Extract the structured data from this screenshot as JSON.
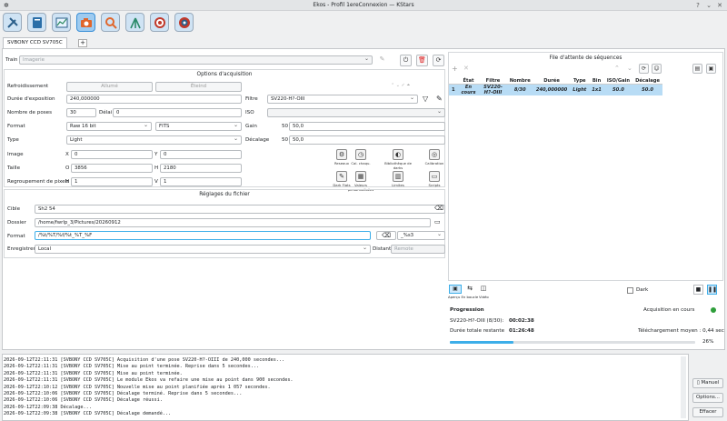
{
  "window": {
    "title": "Ekos - Profil 1ereConnexion — KStars"
  },
  "tab": {
    "label": "SVBONY CCD SV705C",
    "add": "+"
  },
  "train": {
    "label": "Train",
    "value": "Imagerie"
  },
  "acq": {
    "title": "Options d'acquisition",
    "cooling_label": "Refroidissement",
    "cooling_on": "Allumé",
    "cooling_off": "Éteind",
    "exposure_label": "Durée d'exposition",
    "exposure_value": "240,000000",
    "filter_label": "Filtre",
    "filter_value": "SV220-H?-OIII",
    "count_label": "Nombre de poses",
    "count_value": "30",
    "delay_label": "Délai",
    "delay_value": "0",
    "iso_label": "ISO",
    "format_label": "Format",
    "format_value": "Raw 16 bit",
    "encoding_value": "FITS",
    "gain_label": "Gain",
    "gain_min": "50",
    "gain_value": "50,0",
    "type_label": "Type",
    "type_value": "Light",
    "offset_label": "Décalage",
    "offset_min": "50",
    "offset_value": "50,0",
    "image_label": "Image",
    "x_label": "X",
    "x_value": "0",
    "y_label": "Y",
    "y_value": "0",
    "size_label": "Taille",
    "w_label": "O",
    "w_value": "3856",
    "h_label": "H",
    "h_value": "2180",
    "bin_label": "Regroupement de pixels",
    "binh_label": "H",
    "binh_value": "1",
    "binv_label": "V",
    "binv_value": "1"
  },
  "tools": [
    {
      "label": "Reseaux",
      "icon": "cooler-icon"
    },
    {
      "label": "Cal. chaqu.",
      "icon": "clock-icon"
    },
    {
      "label": "Bibliothèque de darks",
      "icon": "dark-library-icon"
    },
    {
      "label": "Calibration",
      "icon": "calibration-icon"
    },
    {
      "label": "Dark Flats",
      "icon": "dark-flats-icon"
    },
    {
      "label": "Valeurs personnalisées",
      "icon": "custom-values-icon"
    },
    {
      "label": "Limites",
      "icon": "limits-icon"
    },
    {
      "label": "Scripts",
      "icon": "scripts-icon"
    }
  ],
  "file": {
    "title": "Réglages du fichier",
    "target_label": "Cible",
    "target_value": "Sh2 54",
    "dir_label": "Dossier",
    "dir_value": "/home/fwrlp_3/Pictures/20260912",
    "format_label": "Format",
    "format_value": "/%t/%T/%f/%t_%T_%F",
    "suffix_value": "_%s3",
    "save_label": "Enregistrer",
    "save_value": "Local",
    "remote_label": "Distant",
    "remote_placeholder": "Remote"
  },
  "queue": {
    "title": "File d'attente de séquences",
    "headers": [
      "État",
      "Filtre",
      "Nombre",
      "Durée",
      "Type",
      "Bin",
      "ISO/Gain",
      "Décalage"
    ],
    "rows": [
      {
        "index": "1",
        "state": "En cours",
        "filter": "SV220-H?-OIII",
        "count": "8/30",
        "duration": "240,000000",
        "type": "Light",
        "bin": "1x1",
        "gain": "50.0",
        "offset": "50.0"
      }
    ]
  },
  "bottom_tools": {
    "preview_label": "Aperçu En boucle",
    "video_label": "Vidéo",
    "dark_label": "Dark"
  },
  "progress": {
    "title": "Progression",
    "status": "Acquisition en cours",
    "status_color": "#2e9e3a",
    "frame_label": "SV220-H?-OIII (8/30):",
    "frame_time": "00:02:38",
    "total_label": "Durée totale restante",
    "total_time": "01:26:48",
    "download_label": "Téléchargement moyen : 0,44 sec",
    "percent_text": "26%",
    "percent_value": 26
  },
  "log": [
    "2026-09-12T22:11:31 [SVBONY CCD SV705C] Acquisition d'une pose SV220-H?-OIII de 240,000 secondes...",
    "2026-09-12T22:11:31 [SVBONY CCD SV705C] Mise au point terminée. Reprise dans 5 secondes...",
    "2026-09-12T22:11:31 [SVBONY CCD SV705C] Mise au point terminée.",
    "2026-09-12T22:11:31 [SVBONY CCD SV705C] Le module Ekos va refaire une mise au point dans 900 secondes.",
    "2026-09-12T22:10:12 [SVBONY CCD SV705C] Nouvelle mise au point planifiée après 1 057 secondes.",
    "2026-09-12T22:10:06 [SVBONY CCD SV705C] Décalage terminé. Reprise dans 5 secondes...",
    "2026-09-12T22:10:06 [SVBONY CCD SV705C] Décalage réussi.",
    "2026-09-12T22:09:38 Décalage...",
    "2026-09-12T22:09:38 [SVBONY CCD SV705C] Décalage demandé..."
  ],
  "log_buttons": {
    "manual": "Manuel",
    "options": "Options...",
    "clear": "Effacer"
  }
}
